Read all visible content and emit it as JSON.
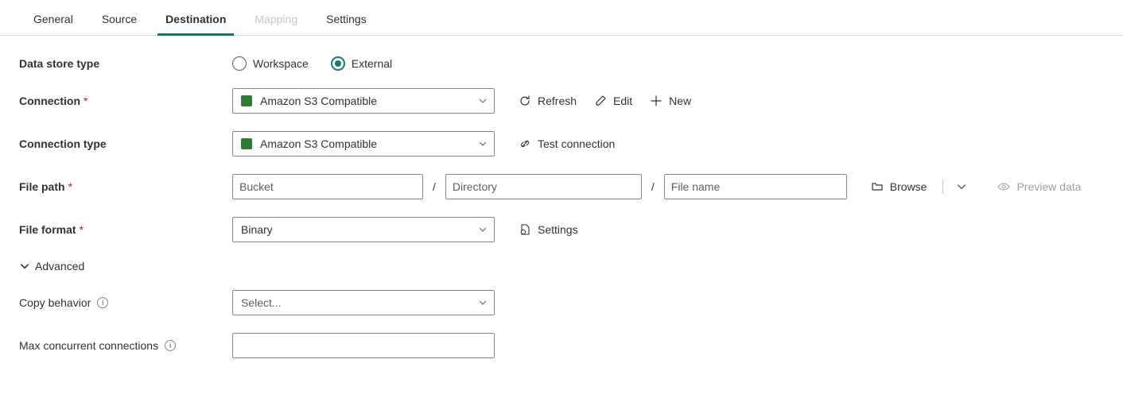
{
  "tabs": {
    "general": "General",
    "source": "Source",
    "destination": "Destination",
    "mapping": "Mapping",
    "settings": "Settings"
  },
  "labels": {
    "data_store_type": "Data store type",
    "connection": "Connection",
    "connection_type": "Connection type",
    "file_path": "File path",
    "file_format": "File format",
    "advanced": "Advanced",
    "copy_behavior": "Copy behavior",
    "max_concurrent": "Max concurrent connections"
  },
  "radios": {
    "workspace": "Workspace",
    "external": "External"
  },
  "connection": {
    "value": "Amazon S3 Compatible",
    "refresh": "Refresh",
    "edit": "Edit",
    "new": "New"
  },
  "connection_type": {
    "value": "Amazon S3 Compatible",
    "test": "Test connection"
  },
  "file_path": {
    "bucket_ph": "Bucket",
    "directory_ph": "Directory",
    "filename_ph": "File name",
    "browse": "Browse",
    "preview": "Preview data"
  },
  "file_format": {
    "value": "Binary",
    "settings": "Settings"
  },
  "copy_behavior": {
    "placeholder": "Select..."
  }
}
